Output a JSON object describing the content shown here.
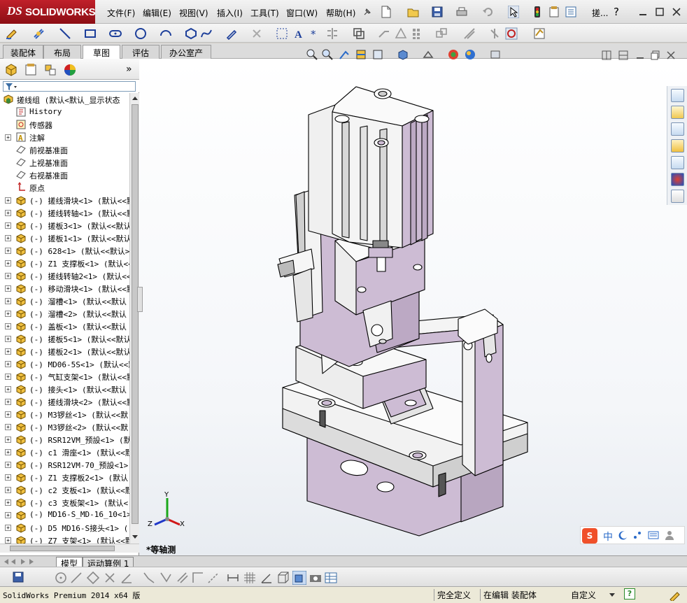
{
  "titlebar": {
    "brand_ds": "DS",
    "brand_name": "SOLIDWORKS",
    "menus": [
      "文件(F)",
      "编辑(E)",
      "视图(V)",
      "插入(I)",
      "工具(T)",
      "窗口(W)",
      "帮助(H)"
    ],
    "doc_title": "搓..."
  },
  "cm_tabs": [
    "装配体",
    "布局",
    "草图",
    "评估",
    "办公室产品"
  ],
  "cm_active_index": 2,
  "fm": {
    "expand_label": "»",
    "root": "搓线组  (默认<默认_显示状态",
    "fixed_items": [
      {
        "label": "History",
        "icon": "history-icon"
      },
      {
        "label": "传感器",
        "icon": "sensor-icon"
      },
      {
        "label": "注解",
        "icon": "annotation-icon"
      },
      {
        "label": "前视基准面",
        "icon": "plane-icon"
      },
      {
        "label": "上视基准面",
        "icon": "plane-icon"
      },
      {
        "label": "右视基准面",
        "icon": "plane-icon"
      },
      {
        "label": "原点",
        "icon": "origin-icon"
      }
    ],
    "components": [
      "(-) 搓线滑块<1> (默认<<默",
      "(-) 搓线转轴<1> (默认<<默",
      "(-) 搓板3<1> (默认<<默认",
      "(-) 搓板1<1> (默认<<默认",
      "(-) 628<1> (默认<<默认>",
      "(-) Z1 支撑板<1> (默认<<",
      "(-) 搓线转轴2<1> (默认<<",
      "(-) 移动滑块<1> (默认<<默",
      "(-) 溜槽<1> (默认<<默认",
      "(-) 溜槽<2> (默认<<默认",
      "(-) 盖板<1> (默认<<默认",
      "(-) 搓板5<1> (默认<<默认",
      "(-) 搓板2<1> (默认<<默认",
      "(-) MD06-5S<1> (默认<<默",
      "(-) 气缸支架<1> (默认<<默",
      "(-) 接头<1> (默认<<默认",
      "(-) 搓线滑块<2> (默认<<默",
      "(-) M3锣丝<1> (默认<<默",
      "(-) M3锣丝<2> (默认<<默",
      "(-) RSR12VM_预設<1> (默",
      "(-) c1 滑座<1> (默认<<默",
      "(-) RSR12VM-70_预設<1>",
      "(-) Z1 支撑板2<1> (默认",
      "(-) c2 支板<1> (默认<<默",
      "(-) c3 支板架<1> (默认<",
      "(-) MD16-S_MD-16_10<1>",
      "(-) D5 MD16-S接头<1> (",
      "(-) Z7 支架<1> (默认<<默"
    ]
  },
  "bottom_tabs": [
    "模型",
    "运动算例 1"
  ],
  "view_label": "*等轴测",
  "triad": {
    "x": "X",
    "y": "Y",
    "z": "Z"
  },
  "ime": {
    "logo": "S",
    "lang": "中"
  },
  "status": {
    "version": "SolidWorks Premium 2014 x64 版",
    "state": "完全定义",
    "mode": "在编辑 装配体",
    "units": "自定义",
    "help": "?"
  },
  "colors": {
    "accent_red": "#b8161e",
    "part_fill": "#cdbcd4",
    "part_light": "#f3f3f3",
    "edge": "#000000"
  }
}
